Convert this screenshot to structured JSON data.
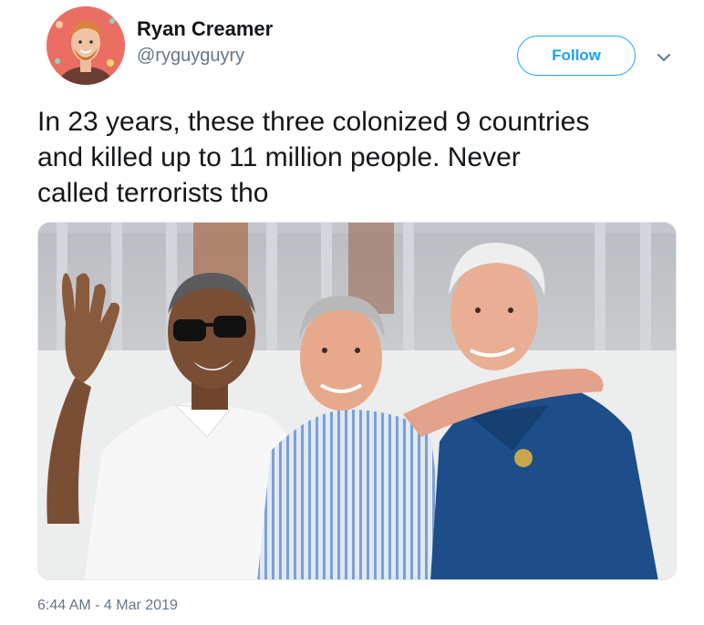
{
  "author": {
    "display_name": "Ryan Creamer",
    "handle": "@ryguyguyry",
    "avatar_icon": "profile-avatar"
  },
  "actions": {
    "follow_label": "Follow",
    "more_icon": "chevron-down-icon"
  },
  "tweet": {
    "text": "In 23 years, these three colonized 9 countries\nand killed up to 11 million people. Never\ncalled terrorists tho",
    "media_icon": "photo-image",
    "timestamp": "6:44 AM - 4 Mar 2019"
  },
  "colors": {
    "follow_blue": "#1da1f2",
    "secondary_text": "#657786",
    "avatar_bg": "#ea6e62"
  }
}
